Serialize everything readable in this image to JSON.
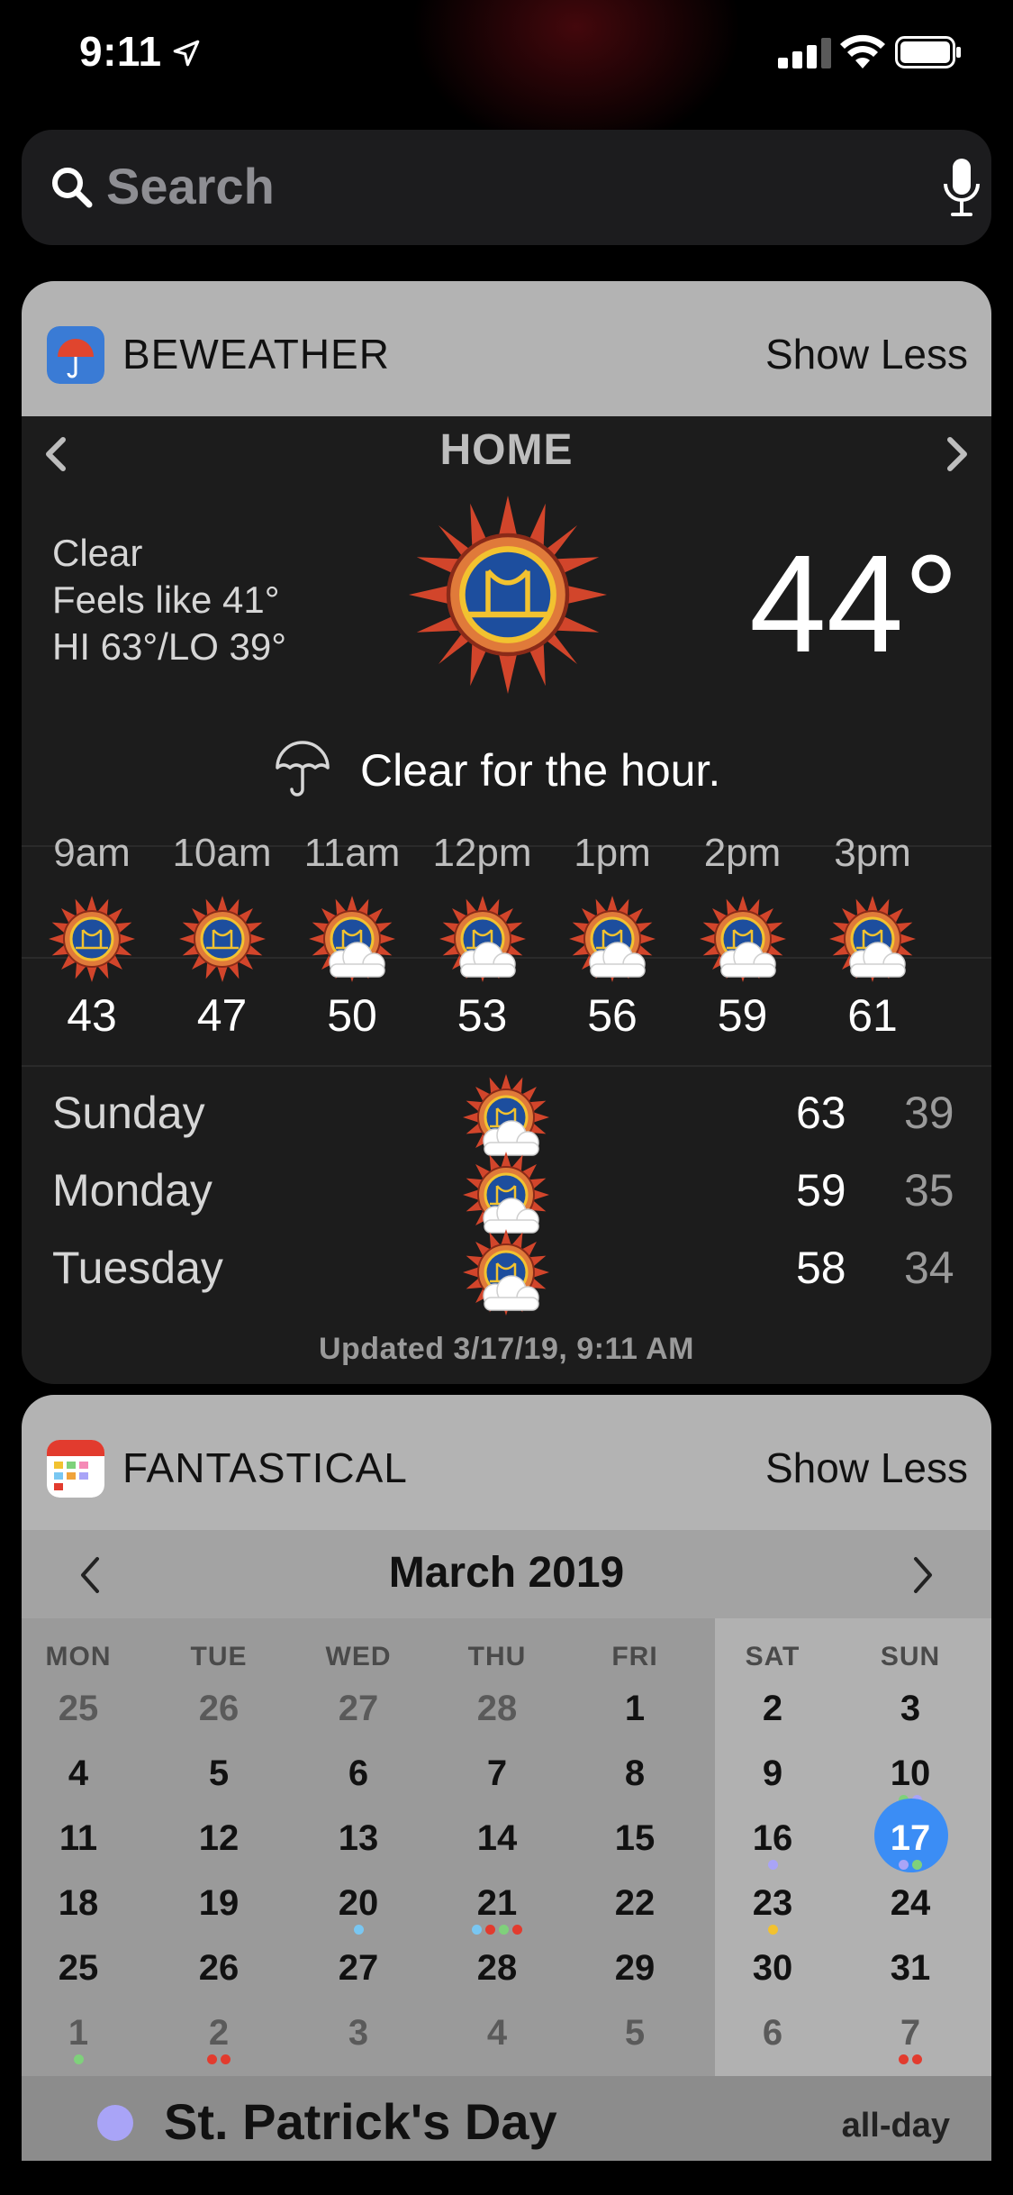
{
  "status_bar": {
    "time": "9:11"
  },
  "search": {
    "placeholder": "Search"
  },
  "weather_widget": {
    "app_name": "BEWEATHER",
    "toggle_label": "Show Less",
    "location": "HOME",
    "condition": "Clear",
    "feels_like": "Feels like 41°",
    "hi_lo": "HI 63°/LO 39°",
    "temperature": "44°",
    "hour_message": "Clear for the hour.",
    "hourly": [
      {
        "time": "9am",
        "temp": "43",
        "icon": "sun-icon"
      },
      {
        "time": "10am",
        "temp": "47",
        "icon": "sun-icon"
      },
      {
        "time": "11am",
        "temp": "50",
        "icon": "partly-cloudy-icon"
      },
      {
        "time": "12pm",
        "temp": "53",
        "icon": "partly-cloudy-icon"
      },
      {
        "time": "1pm",
        "temp": "56",
        "icon": "partly-cloudy-icon"
      },
      {
        "time": "2pm",
        "temp": "59",
        "icon": "partly-cloudy-icon"
      },
      {
        "time": "3pm",
        "temp": "61",
        "icon": "partly-cloudy-icon"
      }
    ],
    "daily": [
      {
        "day": "Sunday",
        "hi": "63",
        "lo": "39",
        "icon": "partly-cloudy-icon"
      },
      {
        "day": "Monday",
        "hi": "59",
        "lo": "35",
        "icon": "partly-cloudy-icon"
      },
      {
        "day": "Tuesday",
        "hi": "58",
        "lo": "34",
        "icon": "partly-cloudy-icon"
      }
    ],
    "updated": "Updated 3/17/19, 9:11 AM"
  },
  "calendar_widget": {
    "app_name": "FANTASTICAL",
    "toggle_label": "Show Less",
    "month_title": "March 2019",
    "weekdays": [
      "MON",
      "TUE",
      "WED",
      "THU",
      "FRI",
      "SAT",
      "SUN"
    ],
    "weeks": [
      [
        "25",
        "26",
        "27",
        "28",
        "1",
        "2",
        "3"
      ],
      [
        "4",
        "5",
        "6",
        "7",
        "8",
        "9",
        "10"
      ],
      [
        "11",
        "12",
        "13",
        "14",
        "15",
        "16",
        "17"
      ],
      [
        "18",
        "19",
        "20",
        "21",
        "22",
        "23",
        "24"
      ],
      [
        "25",
        "26",
        "27",
        "28",
        "29",
        "30",
        "31"
      ],
      [
        "1",
        "2",
        "3",
        "4",
        "5",
        "6",
        "7"
      ]
    ],
    "today": "17",
    "event": {
      "title": "St. Patrick's Day",
      "when": "all-day",
      "color": "#a9a4f7"
    },
    "colors": {
      "today": "#3b8df5"
    }
  }
}
